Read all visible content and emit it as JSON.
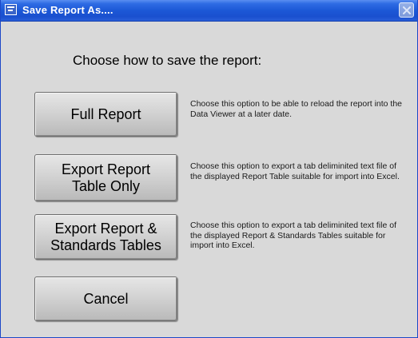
{
  "window": {
    "title": "Save Report As....",
    "icon": "app-window-icon",
    "close_icon": "close-icon"
  },
  "dialog": {
    "heading": "Choose how to save the report:"
  },
  "options": [
    {
      "button_label": "Full Report",
      "description": "Choose this option to be able to reload the report into the Data Viewer at a later date."
    },
    {
      "button_label": "Export Report\nTable Only",
      "description": "Choose this option to export a tab deliminited text file of the displayed Report Table suitable for import into Excel."
    },
    {
      "button_label": "Export Report &\nStandards Tables",
      "description": "Choose this option to export a tab deliminited text file of the displayed Report  & Standards Tables suitable for import into Excel."
    }
  ],
  "cancel": {
    "button_label": "Cancel"
  },
  "colors": {
    "titlebar": "#1c58d6",
    "dialog_background": "#d9d9d9",
    "button_face": "#d3d3d3"
  }
}
